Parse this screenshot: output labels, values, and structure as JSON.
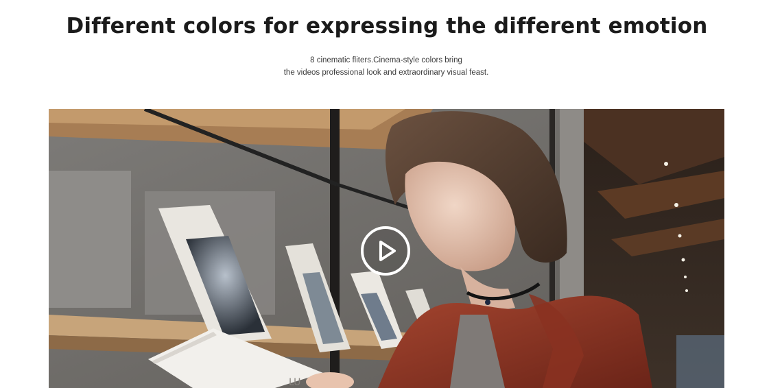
{
  "section": {
    "headline": "Different colors for expressing the different emotion",
    "subtitle_line1": "8 cinematic fliters.Cinema-style colors bring",
    "subtitle_line2": "the videos professional look and extraordinary visual feast."
  },
  "video": {
    "play_icon": "play-icon",
    "book_label": "LU"
  },
  "colors": {
    "headline": "#1b1b1b",
    "subtitle": "#3c3c3c",
    "play_ring": "#ffffff"
  }
}
